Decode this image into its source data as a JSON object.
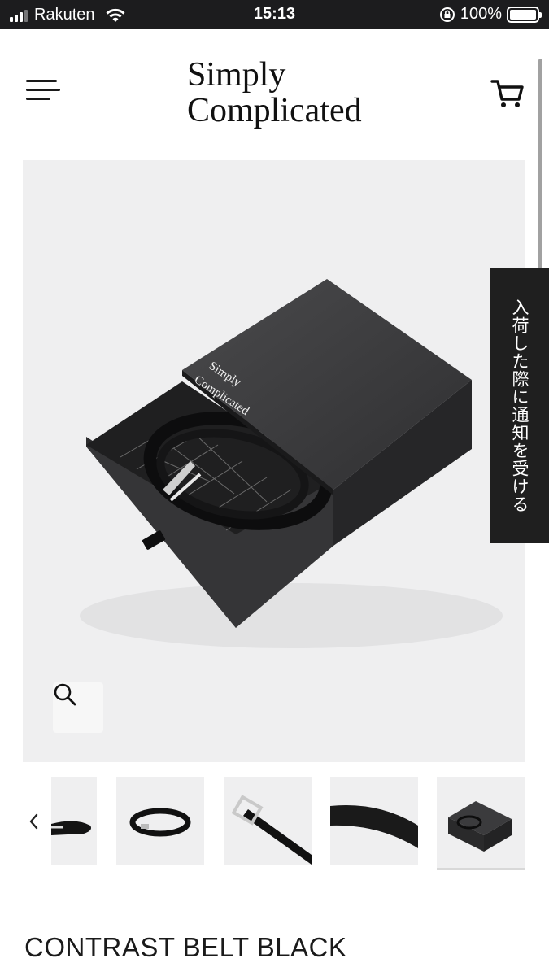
{
  "status_bar": {
    "carrier": "Rakuten",
    "time": "15:13",
    "battery": "100%",
    "battery_level": 1.0
  },
  "header": {
    "brand_line1": "Simply",
    "brand_line2": "Complicated",
    "menu_icon": "hamburger-menu-icon",
    "cart_icon": "cart-icon"
  },
  "product_image": {
    "box_brand_line1": "Simply",
    "box_brand_line2": "Complicated",
    "zoom_icon": "search-icon"
  },
  "notify_tab": {
    "label": "入荷した際に通知を受ける"
  },
  "gallery": {
    "prev_icon": "chevron-left-icon",
    "thumbnails": [
      {
        "subject": "belt-side"
      },
      {
        "subject": "belt-coiled"
      },
      {
        "subject": "belt-buckle"
      },
      {
        "subject": "belt-strap-detail"
      },
      {
        "subject": "belt-box",
        "active": true
      }
    ]
  },
  "product": {
    "title": "CONTRAST BELT BLACK"
  },
  "colors": {
    "status_bar_bg": "#1c1c1e",
    "image_bg": "#efeff0",
    "notify_tab_bg": "#1f1f1f",
    "text": "#1a1a1a"
  }
}
